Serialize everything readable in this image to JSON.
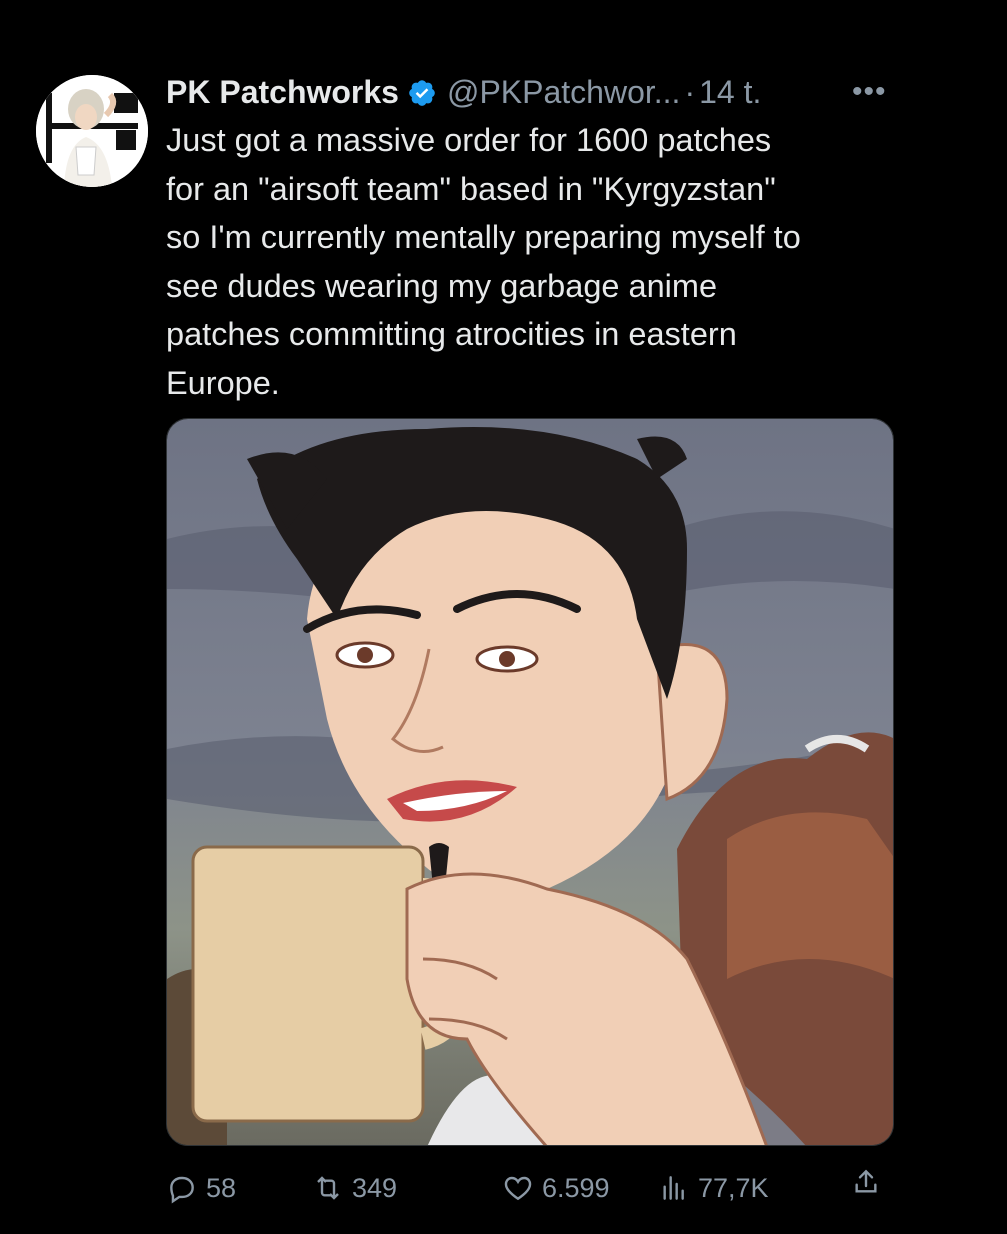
{
  "author": {
    "display_name": "PK Patchworks",
    "handle": "@PKPatchwor...",
    "time_separator": "·",
    "time": "14 t."
  },
  "tweet": {
    "text": "Just got a massive order for 1600 patches\nfor an \"airsoft team\" based in \"Kyrgyzstan\"\nso I'm currently mentally preparing myself to\nsee dudes wearing my garbage anime\npatches committing atrocities in eastern\nEurope."
  },
  "actions": {
    "replies": "58",
    "reposts": "349",
    "likes": "6.599",
    "views": "77,7K"
  },
  "icons": {
    "more": "more-horizontal-icon",
    "verified": "verified-badge-icon",
    "reply": "reply-icon",
    "repost": "repost-icon",
    "like": "heart-icon",
    "views": "views-bar-chart-icon",
    "share": "share-icon"
  },
  "colors": {
    "background": "#000000",
    "text": "#e7e9ea",
    "secondary": "#8b98a5",
    "verified": "#1d9bf0"
  }
}
